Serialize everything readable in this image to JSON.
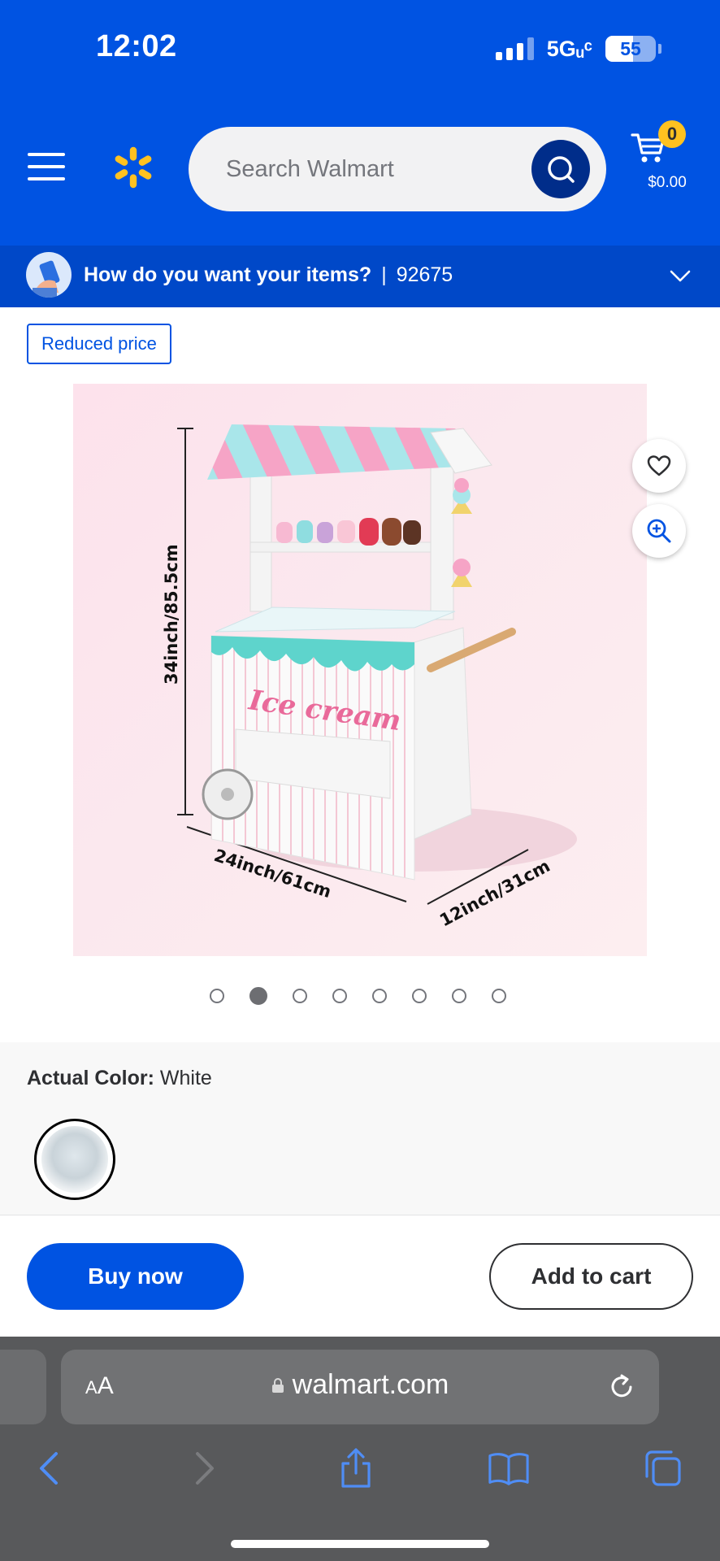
{
  "status_bar": {
    "time": "12:02",
    "network": "5Gᵤᶜ",
    "battery": "55",
    "battery_level": 0.55
  },
  "header": {
    "search": {
      "placeholder": "Search Walmart"
    },
    "cart": {
      "count": "0",
      "total": "$0.00"
    },
    "colors": {
      "brand_blue": "#0053e2",
      "spark_yellow": "#ffc220",
      "search_button": "#002d8a"
    }
  },
  "delivery": {
    "question": "How do you want your items?",
    "separator": "|",
    "zip": "92675"
  },
  "product": {
    "badge": "Reduced price",
    "image": {
      "title_text": "Ice cream",
      "dimension_height": "34inch/85.5cm",
      "dimension_width": "24inch/61cm",
      "dimension_depth": "12inch/31cm"
    },
    "carousel": {
      "total": 8,
      "active_index": 1
    },
    "color_label": "Actual Color:",
    "color_value": "White"
  },
  "actions": {
    "buy_now": "Buy now",
    "add_to_cart": "Add to cart"
  },
  "browser": {
    "aa_label": "AA",
    "url": "walmart.com"
  },
  "icons": [
    "menu-icon",
    "walmart-spark-icon",
    "search-icon",
    "cart-icon",
    "chevron-down-icon",
    "heart-icon",
    "zoom-in-icon",
    "lock-icon",
    "reload-icon",
    "back-icon",
    "forward-icon",
    "share-icon",
    "bookmarks-icon",
    "tabs-icon"
  ]
}
